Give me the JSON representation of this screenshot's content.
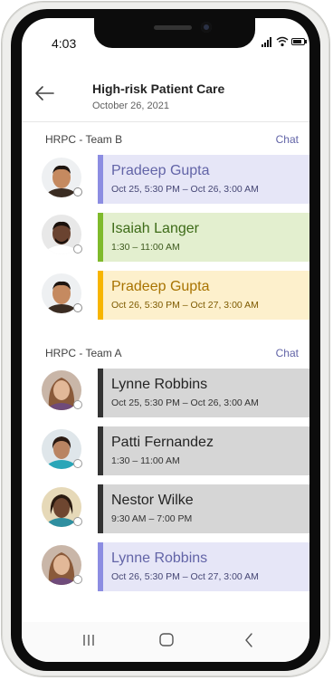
{
  "status_bar": {
    "time": "4:03"
  },
  "header": {
    "title": "High-risk Patient Care",
    "date": "October 26, 2021"
  },
  "teams": [
    {
      "name": "HRPC - Team B",
      "chat_label": "Chat",
      "shifts": [
        {
          "person": "Pradeep Gupta",
          "time": "Oct 25, 5:30 PM – Oct 26, 3:00 AM",
          "color": "purple"
        },
        {
          "person": "Isaiah Langer",
          "time": "1:30 – 11:00 AM",
          "color": "green"
        },
        {
          "person": "Pradeep Gupta",
          "time": "Oct 26, 5:30 PM – Oct 27, 3:00 AM",
          "color": "yellow"
        }
      ]
    },
    {
      "name": "HRPC - Team A",
      "chat_label": "Chat",
      "shifts": [
        {
          "person": "Lynne Robbins",
          "time": "Oct 25, 5:30 PM – Oct 26, 3:00 AM",
          "color": "gray"
        },
        {
          "person": "Patti Fernandez",
          "time": "1:30 – 11:00 AM",
          "color": "gray"
        },
        {
          "person": "Nestor Wilke",
          "time": "9:30 AM – 7:00 PM",
          "color": "gray"
        },
        {
          "person": "Lynne Robbins",
          "time": "Oct 26, 5:30 PM – Oct 27, 3:00 AM",
          "color": "purple"
        }
      ]
    }
  ],
  "colors": {
    "purple_accent": "#8c8de2",
    "green_accent": "#7fba2b",
    "yellow_accent": "#f7b500",
    "gray_accent": "#333333",
    "link": "#6264a7"
  },
  "icons": {
    "back": "arrow-left-icon",
    "nav_recent": "recent-apps-icon",
    "nav_home": "home-icon",
    "nav_back": "back-chevron-icon"
  }
}
